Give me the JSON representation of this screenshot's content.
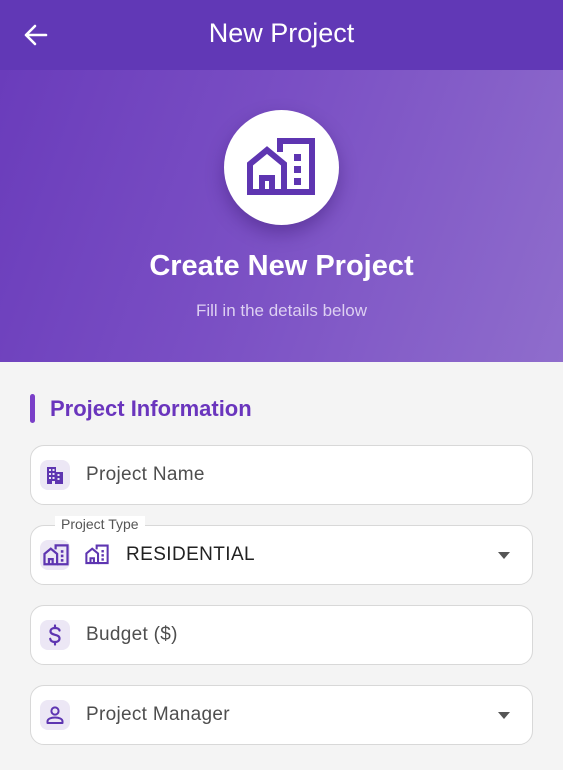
{
  "appbar": {
    "title": "New Project",
    "back_icon": "arrow-left-icon"
  },
  "hero": {
    "icon": "buildings-icon",
    "title": "Create New Project",
    "subtitle": "Fill in the details below"
  },
  "section": {
    "title": "Project Information"
  },
  "form": {
    "project_name": {
      "placeholder": "Project Name",
      "icon": "apartment-icon"
    },
    "project_type": {
      "label": "Project Type",
      "value": "RESIDENTIAL",
      "icon": "buildings-icon",
      "option_icon": "buildings-icon"
    },
    "budget": {
      "placeholder": "Budget ($)",
      "icon": "dollar-icon"
    },
    "project_manager": {
      "placeholder": "Project Manager",
      "icon": "person-icon"
    }
  },
  "colors": {
    "primary": "#6138b6",
    "accent": "#6a35bd",
    "background": "#f4f4f4"
  }
}
